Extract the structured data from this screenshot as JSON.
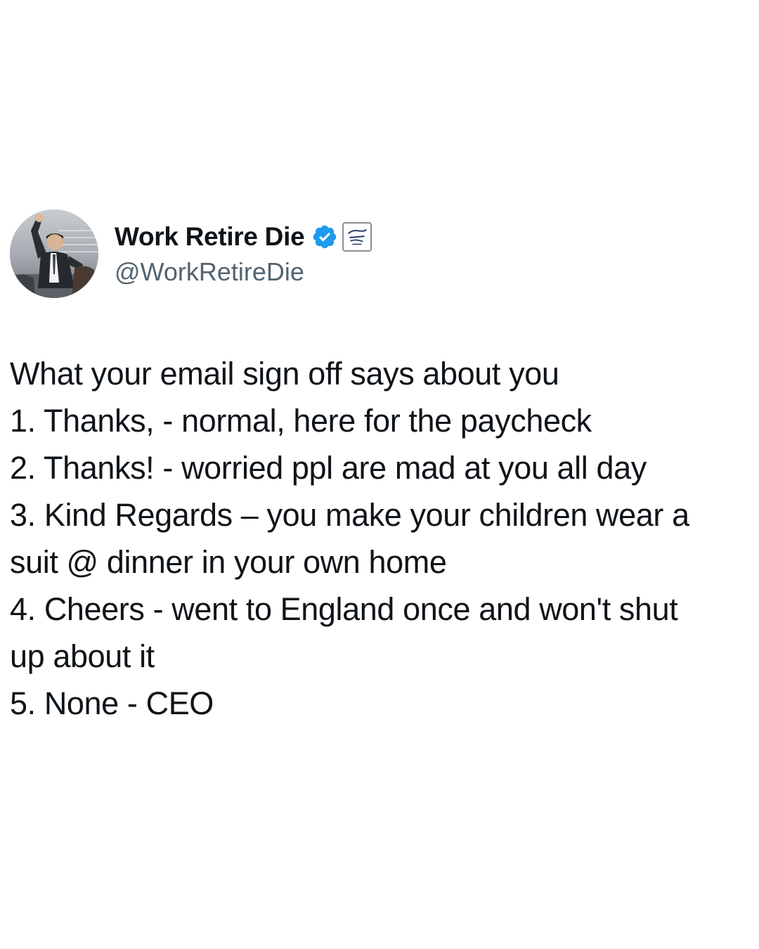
{
  "author": {
    "display_name": "Work Retire Die",
    "handle": "@WorkRetireDie",
    "verified": true,
    "verified_color": "#1d9bf0",
    "avatar_icon": "man-in-suit-celebrating-avatar",
    "affiliate_badge_icon": "affiliate-logo-icon"
  },
  "tweet": {
    "lines": [
      "What your email sign off says about you",
      "1. Thanks, - normal, here for the paycheck",
      "2. Thanks! - worried ppl are mad at you all day",
      "3. Kind Regards – you make your children wear a",
      "suit @ dinner in your own home",
      "4. Cheers - went to England once and won't shut",
      "up about it",
      "5. None - CEO"
    ]
  },
  "colors": {
    "text": "#0f1419",
    "secondary_text": "#536471",
    "background": "#ffffff"
  }
}
